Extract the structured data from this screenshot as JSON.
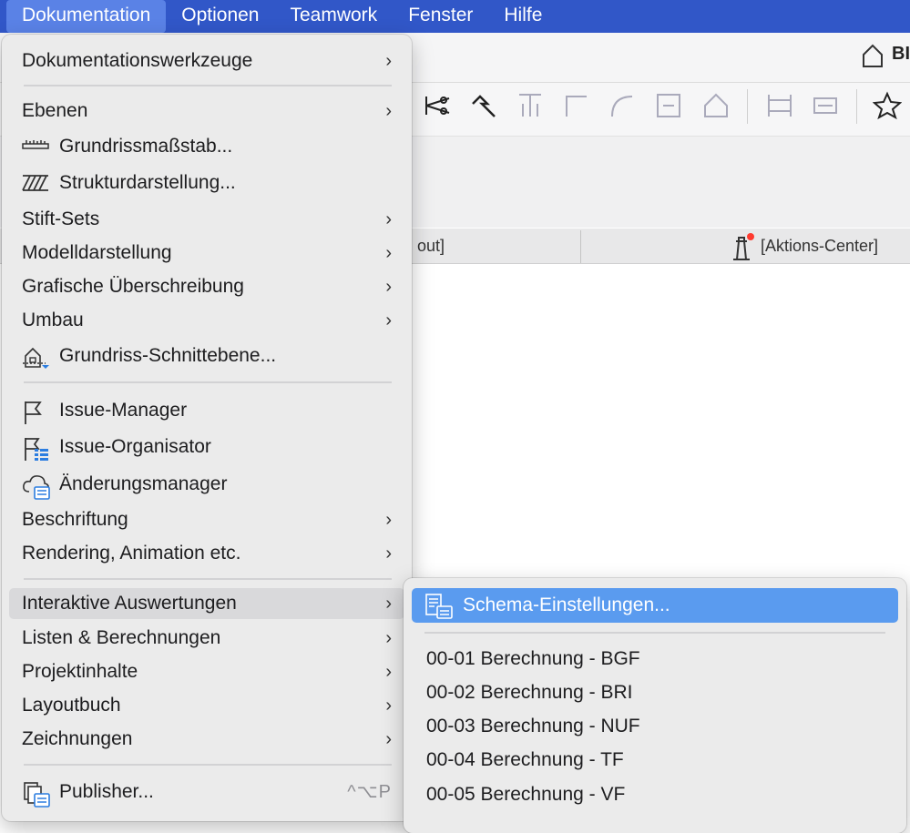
{
  "menubar": {
    "items": [
      "Dokumentation",
      "Optionen",
      "Teamwork",
      "Fenster",
      "Hilfe"
    ],
    "active_index": 0
  },
  "window": {
    "title_partial": "BI",
    "tab_left": "out]",
    "tab_right": "[Aktions-Center]"
  },
  "menu": {
    "items": [
      {
        "label": "Dokumentationswerkzeuge",
        "submenu": true
      },
      {
        "label": "Ebenen",
        "submenu": true
      },
      {
        "label": "Grundrissmaßstab...",
        "icon": "scale-ruler-icon"
      },
      {
        "label": "Strukturdarstellung...",
        "icon": "hatch-pattern-icon"
      },
      {
        "label": "Stift-Sets",
        "submenu": true
      },
      {
        "label": "Modelldarstellung",
        "submenu": true
      },
      {
        "label": "Grafische Überschreibung",
        "submenu": true
      },
      {
        "label": "Umbau",
        "submenu": true
      },
      {
        "label": "Grundriss-Schnittebene...",
        "icon": "floor-plan-cut-plane-icon"
      },
      {
        "label": "Issue-Manager",
        "icon": "flag-icon"
      },
      {
        "label": "Issue-Organisator",
        "icon": "flag-list-icon"
      },
      {
        "label": "Änderungsmanager",
        "icon": "cloud-changes-icon"
      },
      {
        "label": "Beschriftung",
        "submenu": true
      },
      {
        "label": "Rendering, Animation etc.",
        "submenu": true
      },
      {
        "label": "Interaktive Auswertungen",
        "submenu": true,
        "highlighted": true
      },
      {
        "label": "Listen & Berechnungen",
        "submenu": true
      },
      {
        "label": "Projektinhalte",
        "submenu": true
      },
      {
        "label": "Layoutbuch",
        "submenu": true
      },
      {
        "label": "Zeichnungen",
        "submenu": true
      },
      {
        "label": "Publisher...",
        "icon": "publisher-icon",
        "shortcut": "^⌥P"
      }
    ]
  },
  "submenu": {
    "items": [
      {
        "label": "Schema-Einstellungen...",
        "icon": "schema-settings-icon",
        "selected": true
      },
      {
        "label": "00-01 Berechnung - BGF"
      },
      {
        "label": "00-02 Berechnung - BRI"
      },
      {
        "label": "00-03 Berechnung - NUF"
      },
      {
        "label": "00-04 Berechnung - TF"
      },
      {
        "label": "00-05 Berechnung - VF"
      }
    ]
  },
  "colors": {
    "menubar": "#3157c8",
    "menubar_active": "#5a82e6",
    "selection": "#5a9bef",
    "menu_bg": "#ebebeb"
  }
}
